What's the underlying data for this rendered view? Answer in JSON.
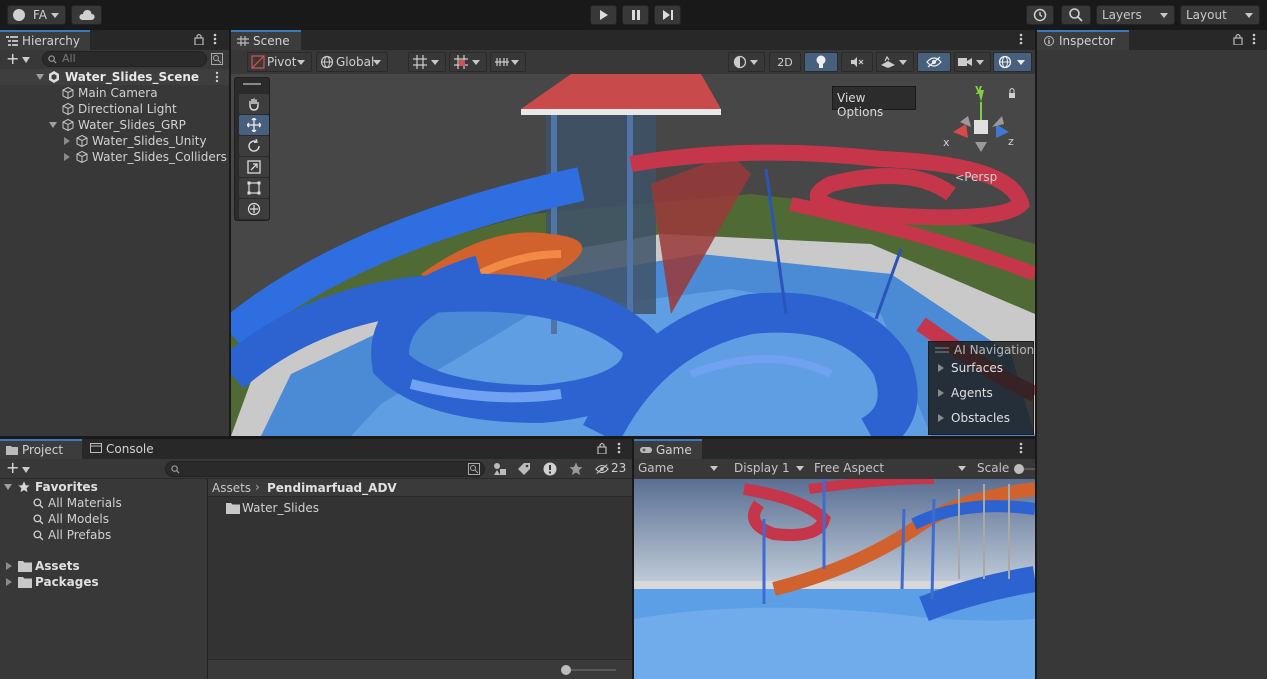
{
  "topbar": {
    "account": "FA",
    "layers": "Layers",
    "layout": "Layout"
  },
  "hierarchy": {
    "tab": "Hierarchy",
    "search_placeholder": "All",
    "scene": "Water_Slides_Scene",
    "items": [
      "Main Camera",
      "Directional Light",
      "Water_Slides_GRP",
      "Water_Slides_Unity",
      "Water_Slides_Colliders"
    ]
  },
  "scene": {
    "tab": "Scene",
    "pivot": "Pivot",
    "global": "Global",
    "mode_2d": "2D",
    "tooltip": "View Options",
    "persp": "Persp",
    "gizmo_x": "x",
    "gizmo_y": "y",
    "gizmo_z": "z",
    "nav_title": "AI Navigation",
    "nav_items": [
      "Surfaces",
      "Agents",
      "Obstacles"
    ]
  },
  "inspector": {
    "tab": "Inspector"
  },
  "project": {
    "tab_project": "Project",
    "tab_console": "Console",
    "hidden_count": "23",
    "favorites": "Favorites",
    "fav_items": [
      "All Materials",
      "All Models",
      "All Prefabs"
    ],
    "roots": [
      "Assets",
      "Packages"
    ],
    "breadcrumb_root": "Assets",
    "breadcrumb_current": "Pendimarfuad_ADV",
    "folder": "Water_Slides"
  },
  "game": {
    "tab": "Game",
    "mode": "Game",
    "display": "Display 1",
    "aspect": "Free Aspect",
    "scale": "Scale"
  }
}
